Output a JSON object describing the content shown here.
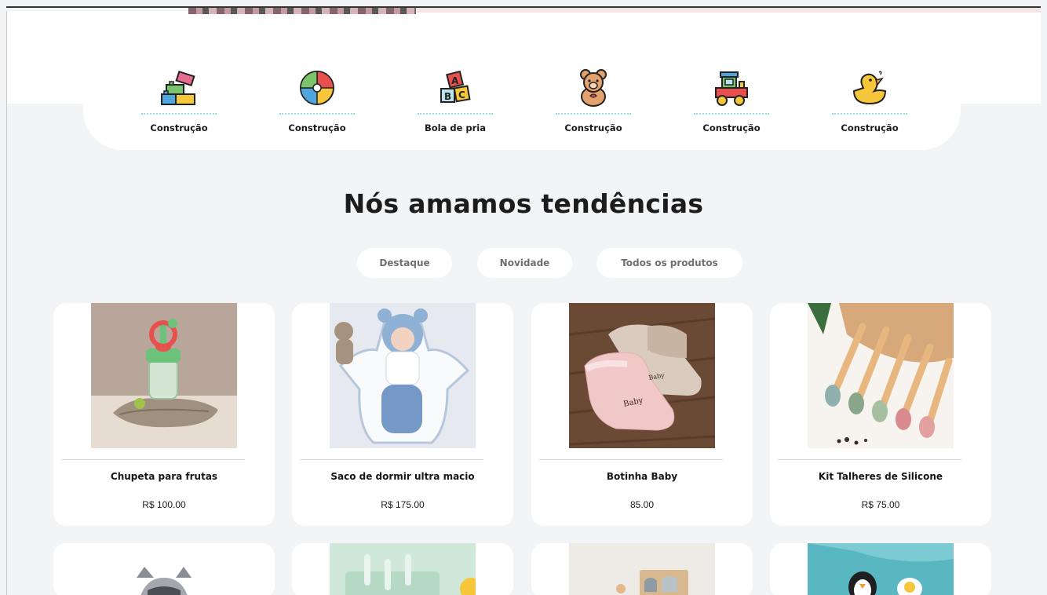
{
  "categories": [
    {
      "label": "Construção",
      "icon": "building-blocks-icon"
    },
    {
      "label": "Construção",
      "icon": "beach-ball-icon"
    },
    {
      "label": "Bola de pria",
      "icon": "abc-blocks-icon"
    },
    {
      "label": "Construção",
      "icon": "teddy-bear-icon"
    },
    {
      "label": "Construção",
      "icon": "toy-train-icon"
    },
    {
      "label": "Construção",
      "icon": "rubber-duck-icon"
    }
  ],
  "section": {
    "title": "Nós amamos tendências"
  },
  "tabs": [
    {
      "label": "Destaque"
    },
    {
      "label": "Novidade"
    },
    {
      "label": "Todos os produtos"
    }
  ],
  "products": [
    {
      "name": "Chupeta para frutas",
      "price": "R$ 100.00"
    },
    {
      "name": "Saco de dormir ultra macio",
      "price": "R$ 175.00"
    },
    {
      "name": "Botinha Baby",
      "price": "85.00"
    },
    {
      "name": "Kit Talheres de Silicone",
      "price": "R$ 75.00"
    }
  ],
  "colors": {
    "page_background": "#f3f4f6",
    "card_background": "#ffffff",
    "dotted_accent": "#9cd9e6",
    "tab_text": "#6f6f6f"
  }
}
